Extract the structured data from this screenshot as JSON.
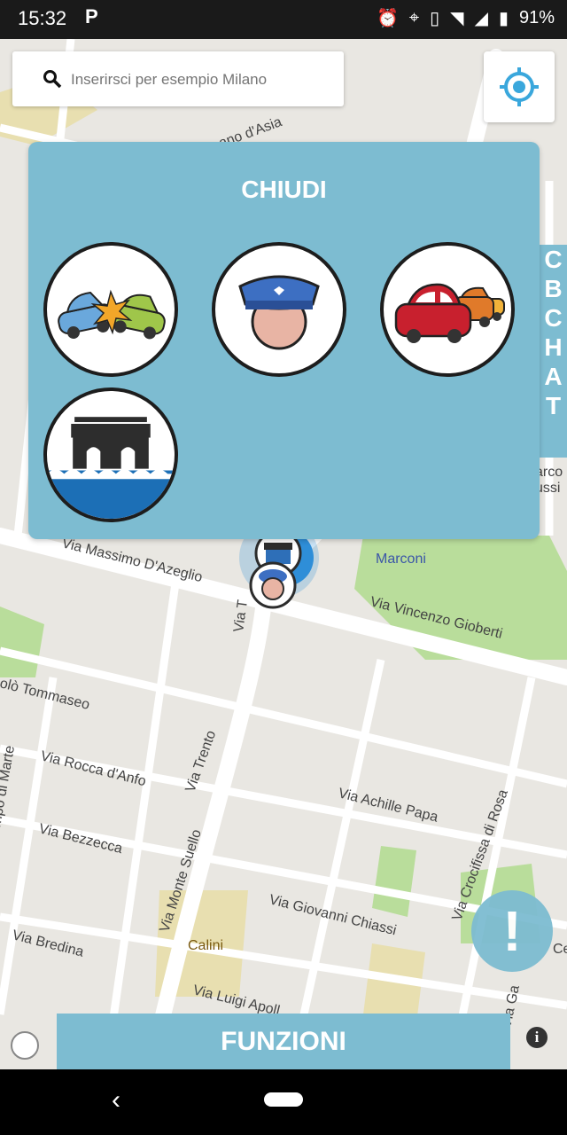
{
  "status": {
    "time": "15:32",
    "parking_icon": "P",
    "battery": "91%"
  },
  "search": {
    "placeholder": "Inserirsci per esempio Milano"
  },
  "panel": {
    "close_label": "CHIUDI",
    "reports": [
      {
        "icon": "car-crash-icon"
      },
      {
        "icon": "police-icon"
      },
      {
        "icon": "traffic-jam-icon"
      },
      {
        "icon": "flood-icon"
      }
    ]
  },
  "side_tab": {
    "letters": [
      "C",
      "B",
      "",
      "C",
      "H",
      "A",
      "T"
    ]
  },
  "map": {
    "labels": [
      "Via Massimo D'Azeglio",
      "Marconi",
      "Via Vincenzo Gioberti",
      "olò Tommaseo",
      "Via Trento",
      "Via Rocca d'Anfo",
      "Via Achille Papa",
      "Via Crocifissa di Rosa",
      "Via Bezzecca",
      "Via Monte Suello",
      "Via Giovanni Chiassi",
      "Via Bredina",
      "Calini",
      "Via Luigi Apoll",
      "mpo di Marte",
      "ano d'Asia",
      "arco",
      "ussi",
      "Ce",
      "Via Ga",
      "Via T"
    ]
  },
  "funzioni_label": "FUNZIONI",
  "alert_label": "!",
  "info_label": "i",
  "colors": {
    "accent": "#7dbcd1",
    "map_bg": "#e9e7e2",
    "park": "#b9dd9b",
    "road": "#ffffff"
  }
}
